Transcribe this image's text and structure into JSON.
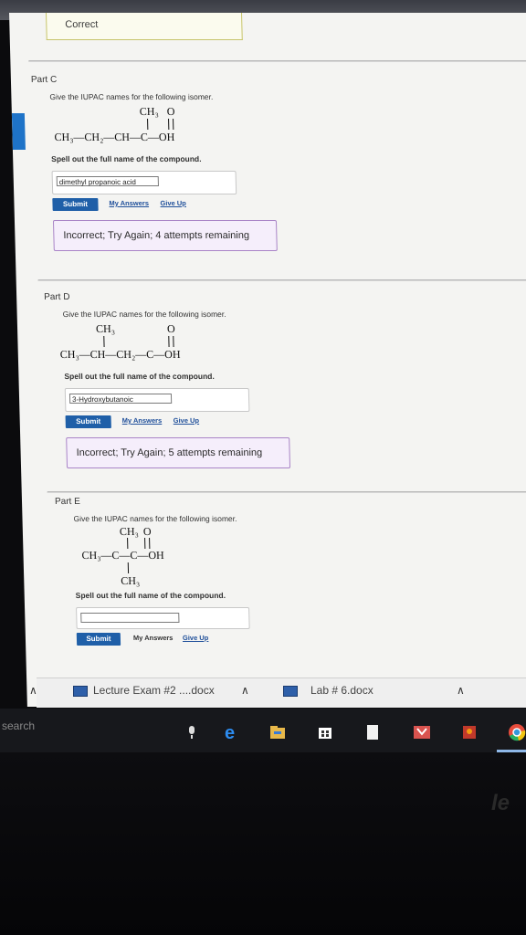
{
  "correct_label": "Correct",
  "parts": [
    {
      "title": "Part C",
      "prompt": "Give the IUPAC names for the following isomer.",
      "formula": {
        "top_ch3": "CH₃",
        "top_o": "O",
        "chain": "CH₃—CH₂—CH—C—OH"
      },
      "spell": "Spell out the full name of the compound.",
      "answer": "dimethyl propanoic acid",
      "submit": "Submit",
      "my_answers": "My Answers",
      "give_up": "Give Up",
      "feedback": "Incorrect; Try Again; 4 attempts remaining"
    },
    {
      "title": "Part D",
      "prompt": "Give the IUPAC names for the following isomer.",
      "formula": {
        "top_ch3": "CH₃",
        "top_o": "O",
        "chain": "CH₃—CH—CH₂—C—OH"
      },
      "spell": "Spell out the full name of the compound.",
      "answer": "3-Hydroxybutanoic",
      "submit": "Submit",
      "my_answers": "My Answers",
      "give_up": "Give Up",
      "feedback": "Incorrect; Try Again; 5 attempts remaining"
    },
    {
      "title": "Part E",
      "prompt": "Give the IUPAC names for the following isomer.",
      "formula": {
        "top_ch3": "CH₃",
        "top_o": "O",
        "chain": "CH₃—C—C—OH",
        "bottom_ch3": "CH₃"
      },
      "spell": "Spell out the full name of the compound.",
      "answer": "",
      "submit": "Submit",
      "my_answers": "My Answers",
      "give_up": "Give Up"
    }
  ],
  "downloads": [
    {
      "name": "Lecture Exam #2 ....docx",
      "icon": "word-doc-icon"
    },
    {
      "name": "Lab # 6.docx",
      "icon": "word-doc-icon"
    }
  ],
  "taskbar": {
    "search_text": "search",
    "icons": [
      "microphone-icon",
      "edge-icon",
      "file-explorer-icon",
      "store-icon",
      "notes-icon",
      "book-icon",
      "app-icon",
      "chrome-icon"
    ]
  },
  "brand_fragment": "le"
}
